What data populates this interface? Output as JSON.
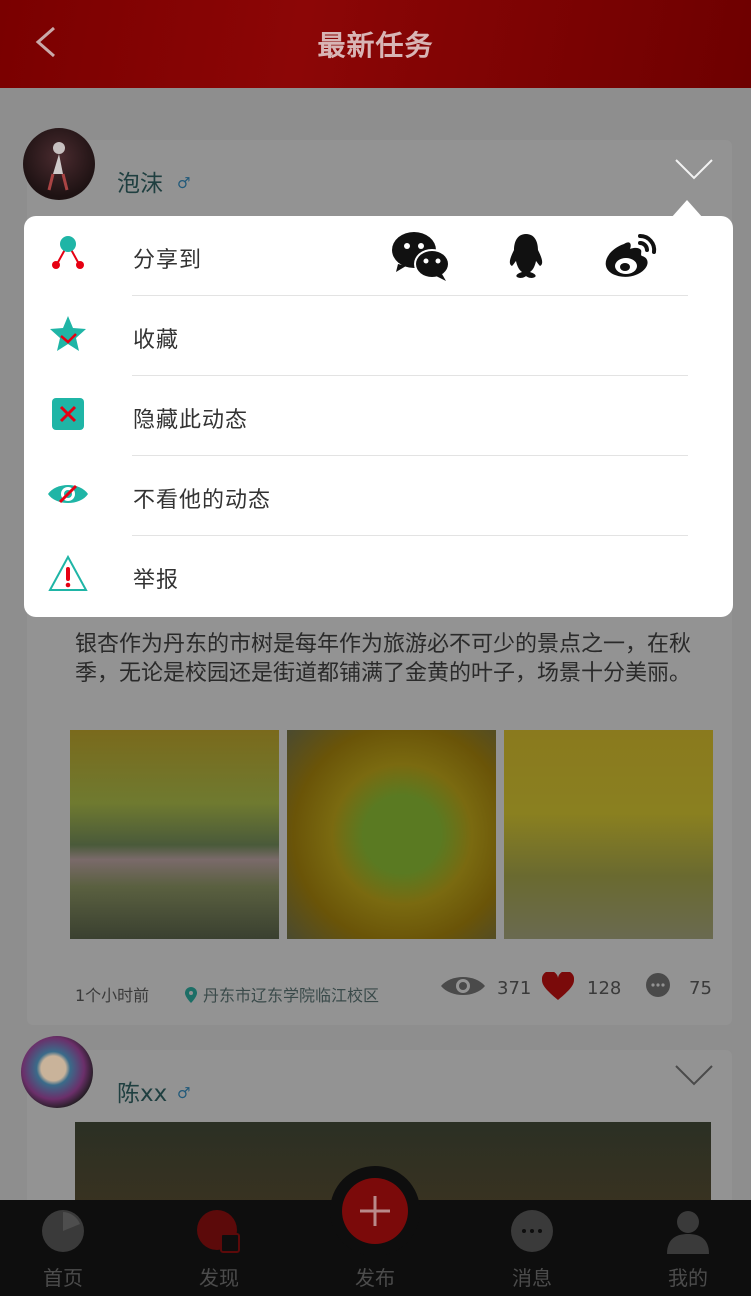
{
  "header": {
    "title": "最新任务"
  },
  "posts": [
    {
      "username": "泡沫",
      "gender": "♂",
      "text": "银杏作为丹东的市树是每年作为旅游必不可少的景点之一，在秋季，无论是校园还是街道都铺满了金黄的叶子，场景十分美丽。",
      "time": "1个小时前",
      "location": "丹东市辽东学院临江校区",
      "views": "371",
      "likes": "128",
      "comments": "75"
    },
    {
      "username": "陈xx",
      "gender": "♂"
    }
  ],
  "popup": {
    "items": [
      {
        "label": "分享到",
        "icon": "share-icon"
      },
      {
        "label": "收藏",
        "icon": "star-icon"
      },
      {
        "label": "隐藏此动态",
        "icon": "close-box-icon"
      },
      {
        "label": "不看他的动态",
        "icon": "eye-off-icon"
      },
      {
        "label": "举报",
        "icon": "warning-icon"
      }
    ],
    "share_targets": [
      "wechat-icon",
      "qq-icon",
      "weibo-icon"
    ]
  },
  "nav": {
    "items": [
      {
        "label": "首页",
        "icon": "home-icon"
      },
      {
        "label": "发现",
        "icon": "discover-icon",
        "active": true
      },
      {
        "label": "发布",
        "icon": "plus-icon"
      },
      {
        "label": "消息",
        "icon": "message-icon"
      },
      {
        "label": "我的",
        "icon": "user-icon"
      }
    ]
  },
  "colors": {
    "accent": "#e60012",
    "popup_icon": "#1fb5a6",
    "warning": "#e60012"
  }
}
